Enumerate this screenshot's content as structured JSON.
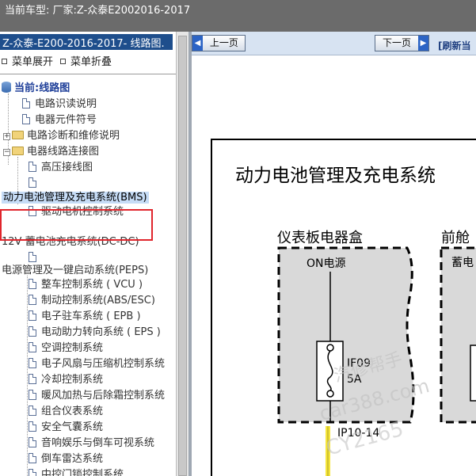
{
  "window": {
    "title": "当前车型:  厂家:Z-众泰E2002016-2017"
  },
  "left_panel": {
    "model_title": "Z-众泰-E200-2016-2017- 线路图.",
    "expand_all": "菜单展开",
    "collapse_all": "菜单折叠"
  },
  "tree": {
    "root": "当前:线路图",
    "items": [
      "电路识读说明",
      "电器元件符号",
      "电路诊断和维修说明",
      "电器线路连接图",
      "高压接线图",
      "",
      "动力电池管理及充电系统(BMS)",
      "驱动电机控制系统",
      "12V 蓄电池充电系统(DC-DC)",
      "",
      "电源管理及一键启动系统(PEPS)",
      "整车控制系统 ( VCU )",
      "制动控制系统(ABS/ESC)",
      "电子驻车系统 ( EPB )",
      "电动助力转向系统 ( EPS )",
      "空调控制系统",
      "电子风扇与压缩机控制系统",
      "冷却控制系统",
      "暖风加热与后除霜控制系统",
      "组合仪表系统",
      "安全气囊系统",
      "音响娱乐与倒车可视系统",
      "倒车雷达系统",
      "中控门锁控制系统"
    ]
  },
  "toolbar": {
    "prev_page": "上一页",
    "next_page": "下一页",
    "refresh": "[刷新当"
  },
  "diagram": {
    "title": "动力电池管理及充电系统",
    "panel_left_label": "仪表板电器盒",
    "panel_right_label": "前舱",
    "on_power_label": "ON电源",
    "right_box_partial": "蓄电",
    "fuse_name": "IF09",
    "fuse_rating": "5A",
    "connector_pin": "IP10-14",
    "watermark_1": "汽修帮手",
    "watermark_2": "car388.com",
    "watermark_3": "CY2165"
  },
  "colors": {
    "title_bar": "#6b6b6b",
    "model_title_bg": "#1e4e8c",
    "highlight_box": "#e0252c",
    "toolbar_bg": "#d7e3f2",
    "panel_fill": "#d9d9d9",
    "wire_yellow": "#f5e53a"
  }
}
